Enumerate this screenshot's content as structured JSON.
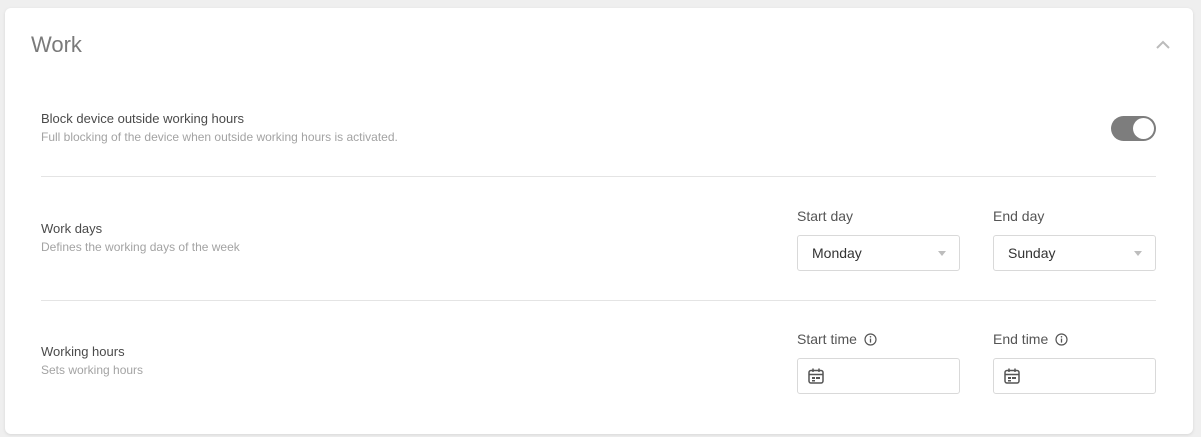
{
  "card": {
    "title": "Work",
    "collapse_icon": "chevron-up-icon"
  },
  "block_device": {
    "title": "Block device outside working hours",
    "description": "Full blocking of the device when outside working hours is activated.",
    "toggle_on": true
  },
  "work_days": {
    "title": "Work days",
    "description": "Defines the working days of the week",
    "start_label": "Start day",
    "start_value": "Monday",
    "end_label": "End day",
    "end_value": "Sunday"
  },
  "working_hours": {
    "title": "Working hours",
    "description": "Sets working hours",
    "start_label": "Start time",
    "start_value": "",
    "end_label": "End time",
    "end_value": "",
    "info_icon": "info-icon",
    "calendar_icon": "calendar-icon"
  },
  "colors": {
    "toggle_bg": "#7d7d7d",
    "divider": "#e4e4e4",
    "title_gray": "#7a7a7a",
    "desc_gray": "#a3a3a3"
  }
}
